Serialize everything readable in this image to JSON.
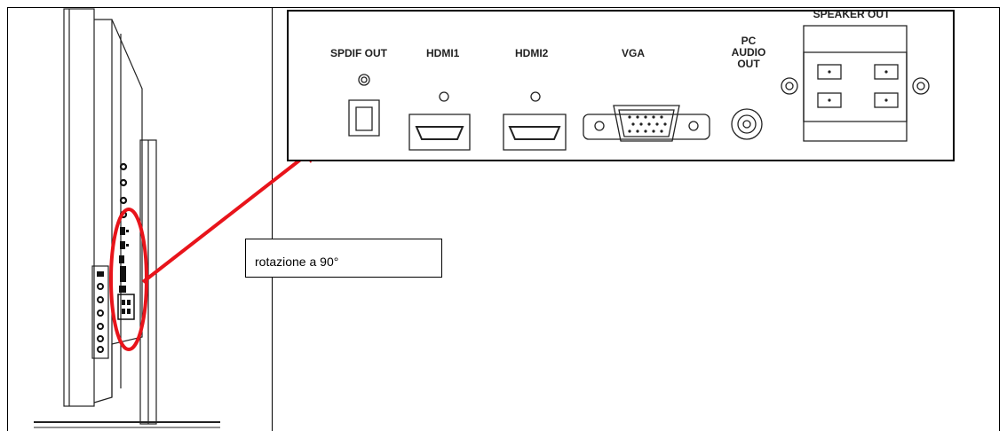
{
  "panel": {
    "labels": {
      "spdif_out": "SPDIF OUT",
      "hdmi1": "HDMI1",
      "hdmi2": "HDMI2",
      "vga": "VGA",
      "pc_audio_out_line1": "PC",
      "pc_audio_out_line2": "AUDIO",
      "pc_audio_out_line3": "OUT",
      "speaker_out": "SPEAKER OUT"
    }
  },
  "callout": {
    "text": "rotazione a 90°"
  },
  "colors": {
    "highlight": "#e8141b",
    "line": "#222222"
  }
}
